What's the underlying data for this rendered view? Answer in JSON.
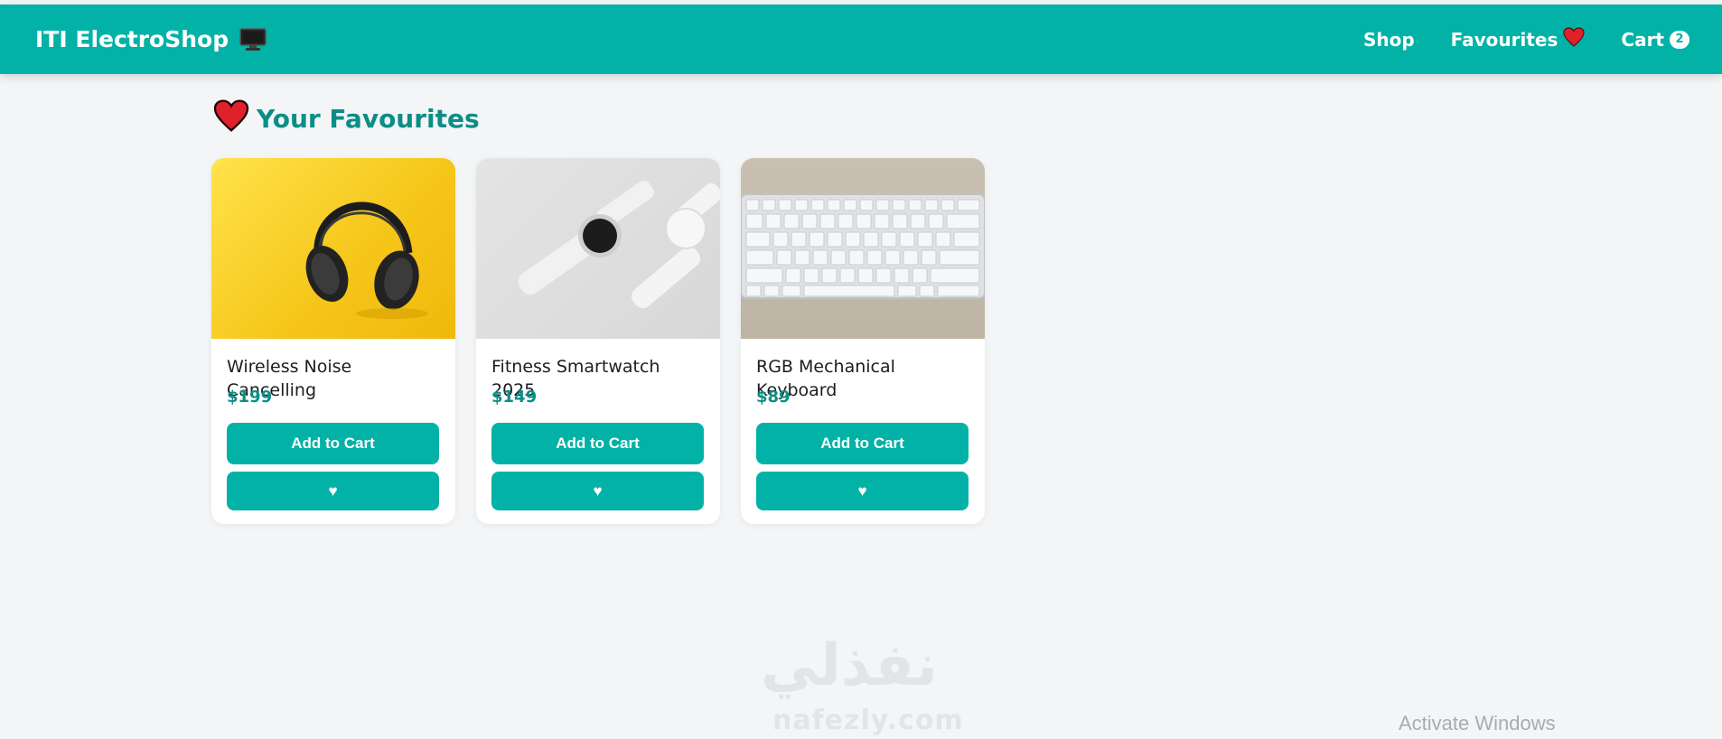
{
  "navbar": {
    "brand": "ITI ElectroShop",
    "brand_icon": "monitor-icon",
    "links": {
      "shop": "Shop",
      "favourites": "Favourites",
      "cart": "Cart"
    },
    "cart_count": "2",
    "accent_color": "#03b2a6"
  },
  "page": {
    "title": "Your Favourites",
    "title_icon": "heart-icon"
  },
  "products": [
    {
      "name": "Wireless Noise Cancelling",
      "price": "$199",
      "add_label": "Add to Cart",
      "fav_label": "♥",
      "image": "headphones-image"
    },
    {
      "name": "Fitness Smartwatch 2025",
      "price": "$149",
      "add_label": "Add to Cart",
      "fav_label": "♥",
      "image": "smartwatch-image"
    },
    {
      "name": "RGB Mechanical Keyboard",
      "price": "$89",
      "add_label": "Add to Cart",
      "fav_label": "♥",
      "image": "keyboard-image"
    }
  ],
  "watermark": {
    "arabic": "نفذلي",
    "latin": "nafezly.com"
  },
  "os_overlay": {
    "activate": "Activate Windows"
  }
}
